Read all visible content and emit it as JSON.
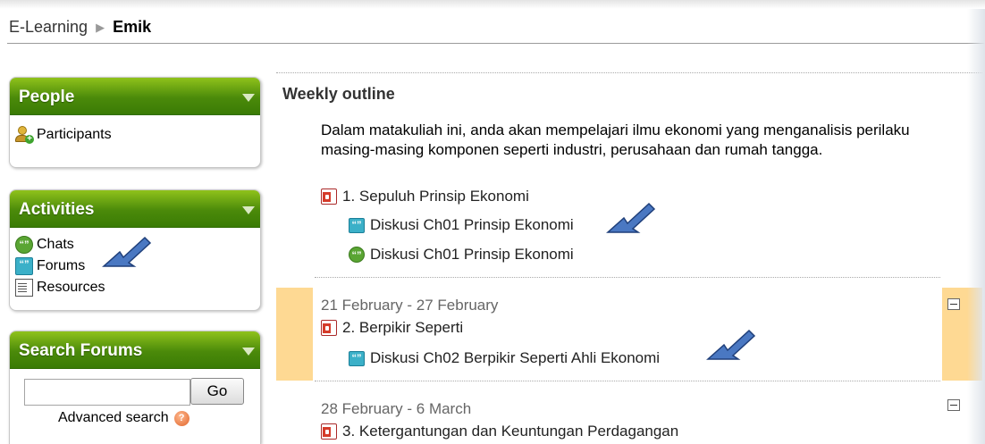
{
  "breadcrumb": {
    "root": "E-Learning",
    "separator": "▶",
    "current": "Emik"
  },
  "sidebar": {
    "people": {
      "title": "People",
      "items": [
        {
          "label": "Participants",
          "icon": "participants-icon"
        }
      ]
    },
    "activities": {
      "title": "Activities",
      "items": [
        {
          "label": "Chats",
          "icon": "chat-icon"
        },
        {
          "label": "Forums",
          "icon": "forum-icon"
        },
        {
          "label": "Resources",
          "icon": "resource-icon"
        }
      ]
    },
    "search_forums": {
      "title": "Search Forums",
      "input_value": "",
      "go_label": "Go",
      "advanced_label": "Advanced search"
    }
  },
  "main": {
    "outline_title": "Weekly outline",
    "summary": "Dalam matakuliah ini, anda akan mempelajari ilmu ekonomi yang menganalisis perilaku masing-masing komponen seperti industri, perusahaan dan rumah tangga.",
    "intro_items": [
      {
        "label": "1. Sepuluh Prinsip Ekonomi",
        "icon": "powerpoint-icon"
      },
      {
        "label": "Diskusi Ch01 Prinsip Ekonomi",
        "icon": "forum-icon"
      },
      {
        "label": "Diskusi Ch01 Prinsip Ekonomi",
        "icon": "chat-icon"
      }
    ],
    "weeks": [
      {
        "date": "21 February - 27 February",
        "items": [
          {
            "label": "2. Berpikir Seperti",
            "icon": "powerpoint-icon"
          },
          {
            "label": "Diskusi Ch02 Berpikir Seperti Ahli Ekonomi",
            "icon": "forum-icon"
          }
        ]
      },
      {
        "date": "28 February - 6 March",
        "items": [
          {
            "label": "3. Ketergantungan dan Keuntungan Perdagangan",
            "icon": "powerpoint-icon"
          }
        ]
      }
    ]
  },
  "colors": {
    "block_header_green": "#4b8a0a",
    "current_week_highlight": "#fed993",
    "annotation_arrow": "#4a78c2"
  }
}
